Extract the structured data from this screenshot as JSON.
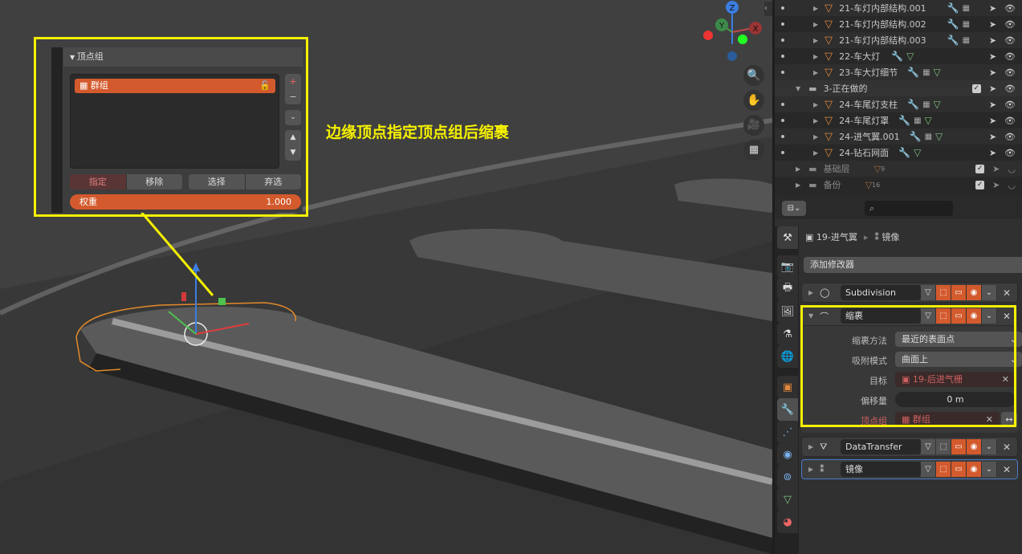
{
  "annotation": "边缘顶点指定顶点组后缩裹",
  "gizmo": {
    "x": "X",
    "y": "Y",
    "z": "Z"
  },
  "outliner": {
    "rows": [
      {
        "label": "21-车灯内部结构.001",
        "kind": "object"
      },
      {
        "label": "21-车灯内部结构.002",
        "kind": "object"
      },
      {
        "label": "21-车灯内部结构.003",
        "kind": "object"
      },
      {
        "label": "22-车大灯",
        "kind": "object"
      },
      {
        "label": "23-车大灯细节",
        "kind": "object"
      },
      {
        "label": "3-正在做的",
        "kind": "collection"
      },
      {
        "label": "24-车尾灯支柱",
        "kind": "object"
      },
      {
        "label": "24-车尾灯罩",
        "kind": "object"
      },
      {
        "label": "24-进气翼.001",
        "kind": "object"
      },
      {
        "label": "24-钻石网面",
        "kind": "object"
      },
      {
        "label": "基础层",
        "kind": "collection",
        "count": "9"
      },
      {
        "label": "备份",
        "kind": "collection",
        "count": "16"
      }
    ]
  },
  "properties": {
    "breadcrumb_object": "19-进气翼",
    "breadcrumb_modifier": "镜像",
    "add_modifier": "添加修改器",
    "modifiers": [
      {
        "name": "Subdivision"
      },
      {
        "name": "缩裹"
      },
      {
        "name": "DataTransfer"
      },
      {
        "name": "镜像"
      }
    ],
    "shrinkwrap": {
      "method_label": "缩裹方法",
      "method_value": "最近的表面点",
      "snap_label": "吸附模式",
      "snap_value": "曲面上",
      "target_label": "目标",
      "target_value": "19-后进气栅",
      "offset_label": "偏移量",
      "offset_value": "0 m",
      "vgroup_label": "顶点组",
      "vgroup_value": "群组"
    }
  },
  "vertex_groups": {
    "title": "顶点组",
    "items": [
      {
        "label": "群组"
      }
    ],
    "assign": "指定",
    "remove": "移除",
    "select": "选择",
    "deselect": "弃选",
    "weight_label": "权重",
    "weight_value": "1.000"
  },
  "colors": {
    "accent": "#d35a2d",
    "highlight": "#f5f000",
    "mesh": "#e0883a"
  }
}
